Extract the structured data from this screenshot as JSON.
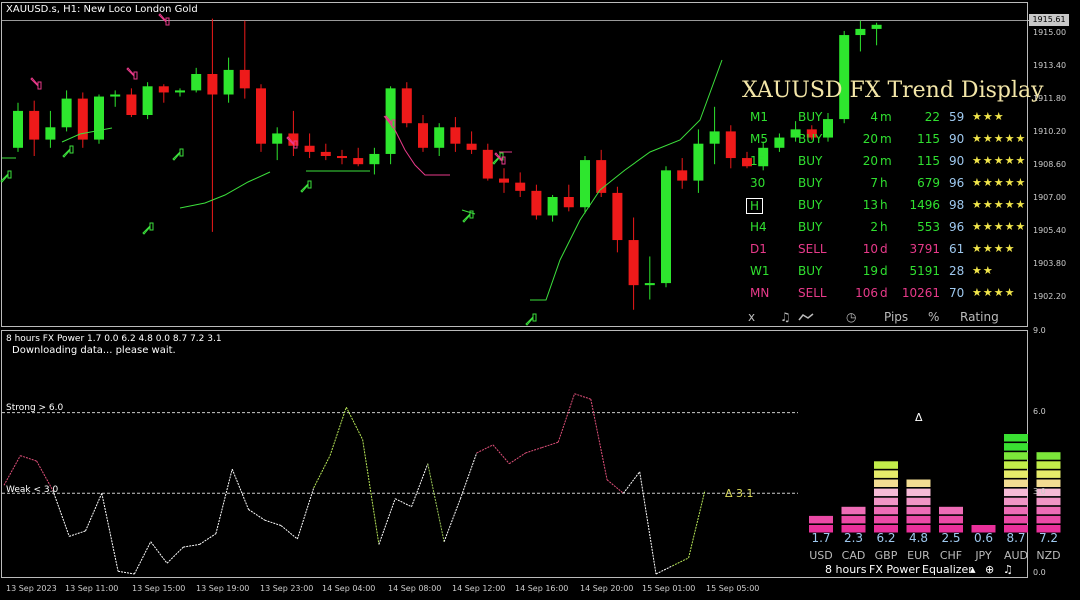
{
  "header": {
    "title": "XAUUSD.s, H1:  New Loco London Gold"
  },
  "price_axis": {
    "labels": [
      "1915.00",
      "1913.40",
      "1911.80",
      "1910.20",
      "1908.60",
      "1907.00",
      "1905.40",
      "1903.80",
      "1902.20"
    ],
    "current": "1915.61"
  },
  "trend_display": {
    "title": "XAUUSD FX Trend Display",
    "rows": [
      {
        "tf": "M1",
        "signal": "BUY",
        "dur_n": "4",
        "dur_u": "m",
        "pips": "22",
        "pct": "59",
        "rating": "★★★",
        "color": "#30e030"
      },
      {
        "tf": "M5",
        "signal": "BUY",
        "dur_n": "20",
        "dur_u": "m",
        "pips": "115",
        "pct": "90",
        "rating": "★★★★★",
        "color": "#30e030"
      },
      {
        "tf": "15",
        "signal": "BUY",
        "dur_n": "20",
        "dur_u": "m",
        "pips": "115",
        "pct": "90",
        "rating": "★★★★★",
        "color": "#30e030"
      },
      {
        "tf": "30",
        "signal": "BUY",
        "dur_n": "7",
        "dur_u": "h",
        "pips": "679",
        "pct": "96",
        "rating": "★★★★★",
        "color": "#30e030"
      },
      {
        "tf": "H",
        "signal": "BUY",
        "dur_n": "13",
        "dur_u": "h",
        "pips": "1496",
        "pct": "98",
        "rating": "★★★★★",
        "color": "#30e030"
      },
      {
        "tf": "H4",
        "signal": "BUY",
        "dur_n": "2",
        "dur_u": "h",
        "pips": "553",
        "pct": "96",
        "rating": "★★★★★",
        "color": "#30e030"
      },
      {
        "tf": "D1",
        "signal": "SELL",
        "dur_n": "10",
        "dur_u": "d",
        "pips": "3791",
        "pct": "61",
        "rating": "★★★★",
        "color": "#e83a8a"
      },
      {
        "tf": "W1",
        "signal": "BUY",
        "dur_n": "19",
        "dur_u": "d",
        "pips": "5191",
        "pct": "28",
        "rating": "★★",
        "color": "#30e030"
      },
      {
        "tf": "MN",
        "signal": "SELL",
        "dur_n": "106",
        "dur_u": "d",
        "pips": "10261",
        "pct": "70",
        "rating": "★★★★",
        "color": "#e83a8a"
      }
    ],
    "footer": {
      "close": "x",
      "sound": "♫",
      "clock": "◷",
      "pips": "Pips",
      "pct": "%",
      "rating": "Rating"
    }
  },
  "indicator": {
    "header": "8 hours FX Power 1.7 0.0 6.2 4.8 0.0 8.7 7.2 3.1",
    "status": "Downloading data... please wait.",
    "strong_label": "Strong > 6.0",
    "weak_label": "Weak < 3.0",
    "delta_label": "Δ 3.1",
    "delta_marker": "Δ",
    "axis": [
      "9.0",
      "6.0",
      "3.0",
      "0.0"
    ],
    "currencies": [
      {
        "name": "USD",
        "value": "1.7",
        "level": 1.7
      },
      {
        "name": "CAD",
        "value": "2.3",
        "level": 2.3
      },
      {
        "name": "GBP",
        "value": "6.2",
        "level": 6.2
      },
      {
        "name": "EUR",
        "value": "4.8",
        "level": 4.8
      },
      {
        "name": "CHF",
        "value": "2.5",
        "level": 2.5
      },
      {
        "name": "JPY",
        "value": "0.6",
        "level": 0.6
      },
      {
        "name": "AUD",
        "value": "8.7",
        "level": 8.7
      },
      {
        "name": "NZD",
        "value": "7.2",
        "level": 7.2
      }
    ],
    "menu": {
      "period": "8 hours",
      "power": "FX Power",
      "equalizer": "Equalizer",
      "up": "▴",
      "target": "⊕",
      "note": "♫"
    }
  },
  "time_axis": [
    "13 Sep 2023",
    "13 Sep 11:00",
    "13 Sep 15:00",
    "13 Sep 19:00",
    "13 Sep 23:00",
    "14 Sep 04:00",
    "14 Sep 08:00",
    "14 Sep 12:00",
    "14 Sep 16:00",
    "14 Sep 20:00",
    "15 Sep 01:00",
    "15 Sep 05:00"
  ],
  "colors": {
    "bull": "#2ee62e",
    "bear": "#ee1a1a",
    "trail_bull": "#3ce03c",
    "trail_bear": "#e83a8a"
  },
  "candles": [
    [
      1909.4,
      1911.6,
      1909.2,
      1911.2
    ],
    [
      1911.2,
      1911.7,
      1909.0,
      1909.8
    ],
    [
      1909.8,
      1911.2,
      1909.4,
      1910.4
    ],
    [
      1910.4,
      1912.2,
      1910.2,
      1911.8
    ],
    [
      1911.8,
      1912.1,
      1909.4,
      1909.8
    ],
    [
      1909.8,
      1912.0,
      1909.6,
      1911.9
    ],
    [
      1911.9,
      1912.2,
      1911.4,
      1912.0
    ],
    [
      1912.0,
      1912.3,
      1910.9,
      1911.0
    ],
    [
      1911.0,
      1912.6,
      1910.8,
      1912.4
    ],
    [
      1912.4,
      1912.5,
      1911.6,
      1912.1
    ],
    [
      1912.1,
      1912.3,
      1911.9,
      1912.2
    ],
    [
      1912.2,
      1913.3,
      1912.1,
      1913.0
    ],
    [
      1913.0,
      1915.7,
      1905.3,
      1912.0
    ],
    [
      1912.0,
      1913.8,
      1911.6,
      1913.2
    ],
    [
      1913.2,
      1915.6,
      1911.8,
      1912.3
    ],
    [
      1912.3,
      1912.5,
      1909.2,
      1909.6
    ],
    [
      1909.6,
      1910.4,
      1908.8,
      1910.1
    ],
    [
      1910.1,
      1911.2,
      1909.0,
      1909.5
    ],
    [
      1909.5,
      1910.1,
      1908.9,
      1909.2
    ],
    [
      1909.2,
      1909.6,
      1908.8,
      1909.0
    ],
    [
      1909.0,
      1909.3,
      1908.6,
      1908.9
    ],
    [
      1908.9,
      1909.4,
      1908.5,
      1908.6
    ],
    [
      1908.6,
      1909.4,
      1908.1,
      1909.1
    ],
    [
      1909.1,
      1912.4,
      1908.6,
      1912.3
    ],
    [
      1912.3,
      1912.6,
      1910.4,
      1910.6
    ],
    [
      1910.6,
      1911.0,
      1909.2,
      1909.4
    ],
    [
      1909.4,
      1910.6,
      1909.0,
      1910.4
    ],
    [
      1910.4,
      1910.9,
      1909.2,
      1909.6
    ],
    [
      1909.6,
      1910.2,
      1909.1,
      1909.3
    ],
    [
      1909.3,
      1909.6,
      1907.8,
      1907.9
    ],
    [
      1907.9,
      1908.4,
      1907.2,
      1907.7
    ],
    [
      1907.7,
      1908.2,
      1907.0,
      1907.3
    ],
    [
      1907.3,
      1907.6,
      1905.9,
      1906.1
    ],
    [
      1906.1,
      1907.1,
      1905.8,
      1907.0
    ],
    [
      1907.0,
      1907.6,
      1906.3,
      1906.5
    ],
    [
      1906.5,
      1909.0,
      1906.2,
      1908.8
    ],
    [
      1908.8,
      1909.3,
      1907.0,
      1907.2
    ],
    [
      1907.2,
      1907.5,
      1904.3,
      1904.9
    ],
    [
      1904.9,
      1906.0,
      1901.5,
      1902.7
    ],
    [
      1902.7,
      1904.1,
      1902.0,
      1902.8
    ],
    [
      1902.8,
      1908.5,
      1902.6,
      1908.3
    ],
    [
      1908.3,
      1908.9,
      1907.4,
      1907.8
    ],
    [
      1907.8,
      1910.3,
      1907.2,
      1909.6
    ],
    [
      1909.6,
      1911.4,
      1908.6,
      1910.2
    ],
    [
      1910.2,
      1910.5,
      1908.4,
      1908.9
    ],
    [
      1908.9,
      1909.2,
      1908.4,
      1908.5
    ],
    [
      1908.5,
      1909.7,
      1908.3,
      1909.4
    ],
    [
      1909.4,
      1910.1,
      1909.2,
      1909.9
    ],
    [
      1909.9,
      1910.7,
      1909.7,
      1910.3
    ],
    [
      1910.3,
      1910.5,
      1909.8,
      1909.9
    ],
    [
      1909.9,
      1911.1,
      1909.7,
      1910.8
    ],
    [
      1910.8,
      1915.1,
      1910.6,
      1914.9
    ],
    [
      1914.9,
      1915.6,
      1914.1,
      1915.2
    ],
    [
      1915.2,
      1915.5,
      1914.4,
      1915.4
    ]
  ],
  "fx_power_line": [
    3.3,
    4.4,
    4.2,
    3.1,
    1.4,
    1.6,
    3.0,
    0.1,
    0.0,
    1.2,
    0.4,
    1.0,
    1.1,
    1.5,
    3.9,
    2.4,
    2.0,
    1.8,
    1.3,
    3.2,
    4.4,
    6.2,
    5.0,
    1.1,
    2.8,
    2.5,
    4.1,
    1.2,
    2.8,
    4.5,
    4.8,
    4.1,
    4.5,
    4.7,
    4.9,
    6.7,
    6.5,
    3.5,
    3.0,
    3.8,
    0.0,
    0.3,
    0.6,
    3.1
  ]
}
